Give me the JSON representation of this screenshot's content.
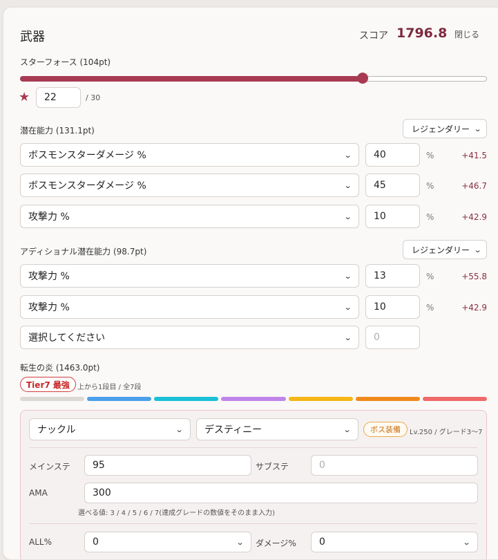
{
  "header": {
    "title": "武器",
    "score_label": "スコア",
    "score_value": "1796.8",
    "close_label": "閉じる"
  },
  "starforce": {
    "label": "スターフォース (104pt)",
    "value": 22,
    "max_label": "/ 30",
    "fraction": 0.7333
  },
  "potential": {
    "label": "潜在能力 (131.1pt)",
    "grade": "レジェンダリー",
    "rows": [
      {
        "stat": "ボスモンスターダメージ %",
        "value": "40",
        "unit": "%",
        "delta": "+41.5"
      },
      {
        "stat": "ボスモンスターダメージ %",
        "value": "45",
        "unit": "%",
        "delta": "+46.7"
      },
      {
        "stat": "攻撃力 %",
        "value": "10",
        "unit": "%",
        "delta": "+42.9"
      }
    ]
  },
  "additional": {
    "label": "アディショナル潜在能力 (98.7pt)",
    "grade": "レジェンダリー",
    "rows": [
      {
        "stat": "攻撃力 %",
        "value": "13",
        "unit": "%",
        "delta": "+55.8"
      },
      {
        "stat": "攻撃力 %",
        "value": "10",
        "unit": "%",
        "delta": "+42.9"
      }
    ],
    "empty_select": "選択してください",
    "empty_placeholder": "0"
  },
  "flame": {
    "label": "転生の炎 (1463.0pt)",
    "tier_badge": "Tier7 最強",
    "tier_desc": "上から1段目 / 全7段",
    "segments": [
      "#dcd8d4",
      "#4aa0ea",
      "#1bbfd6",
      "#c084ea",
      "#f5b616",
      "#f08a1c",
      "#f06a6a"
    ],
    "weapon_type": "ナックル",
    "weapon_set": "デスティニー",
    "boss_badge": "ボス装備",
    "level_text": "Lv.250 / グレード3〜7",
    "main_stat_label": "メインステ",
    "main_stat_value": "95",
    "sub_stat_label": "サブステ",
    "sub_stat_placeholder": "0",
    "ama_label": "AMA",
    "ama_value": "300",
    "hint": "選べる値: 3 / 4 / 5 / 6 / 7(達成グレードの数値をそのまま入力)",
    "all_label": "ALL%",
    "all_value": "0",
    "dmg_label": "ダメージ%",
    "dmg_value": "0"
  },
  "colors": {
    "accent": "#a83a52",
    "score": "#7e2a3e"
  }
}
